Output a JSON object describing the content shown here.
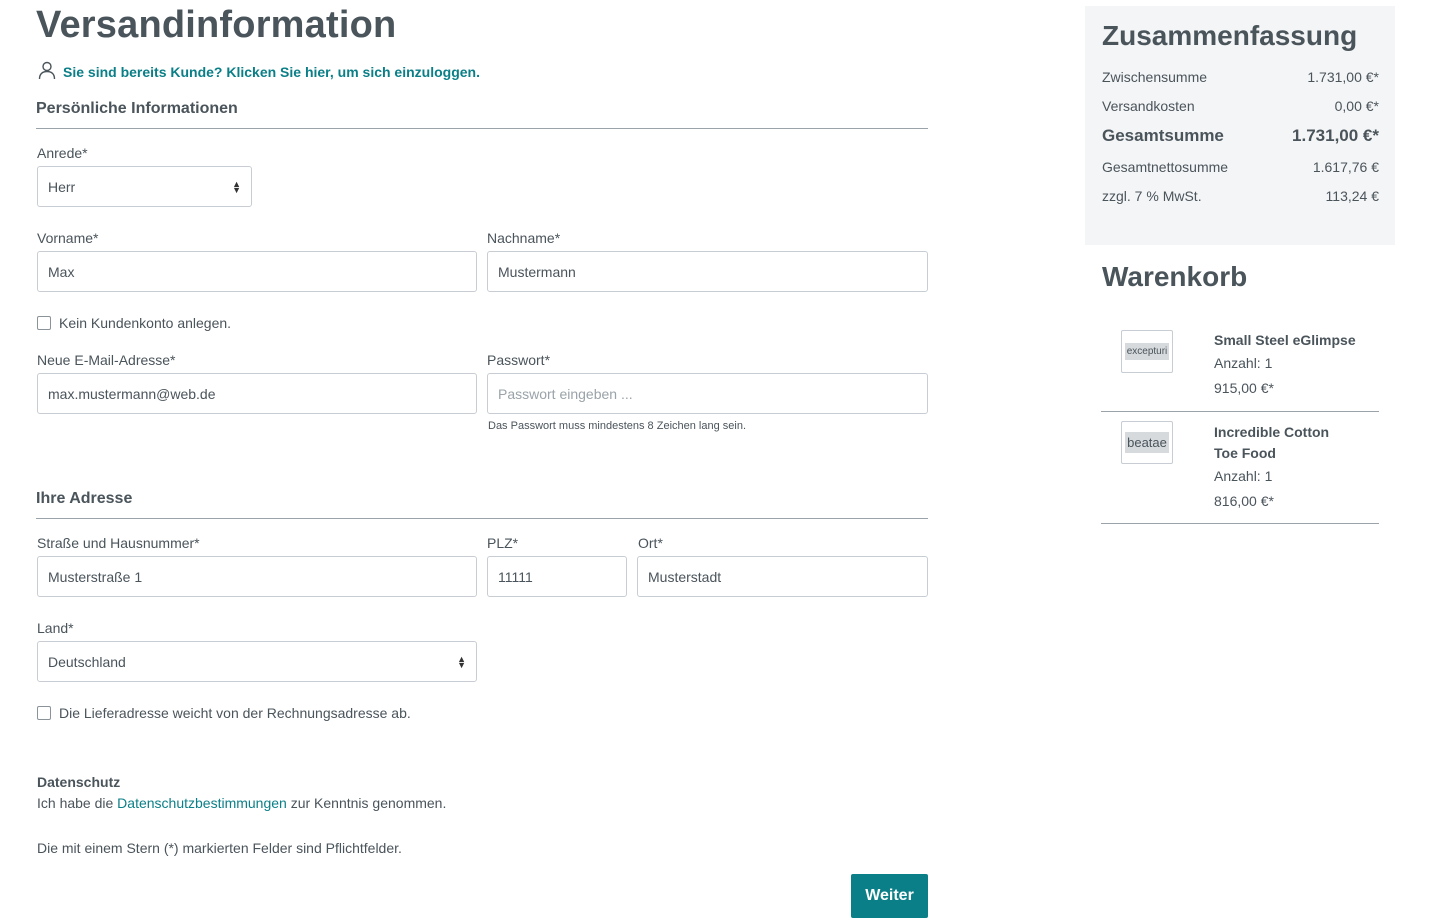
{
  "page": {
    "title": "Versandinformation",
    "login_link": "Sie sind bereits Kunde? Klicken Sie hier, um sich einzuloggen."
  },
  "personal": {
    "section_title": "Persönliche Informationen",
    "salutation": {
      "label": "Anrede*",
      "value": "Herr"
    },
    "first_name": {
      "label": "Vorname*",
      "value": "Max"
    },
    "last_name": {
      "label": "Nachname*",
      "value": "Mustermann"
    },
    "no_account": {
      "label": "Kein Kundenkonto anlegen.",
      "checked": false
    },
    "email": {
      "label": "Neue E-Mail-Adresse*",
      "value": "max.mustermann@web.de"
    },
    "password": {
      "label": "Passwort*",
      "placeholder": "Passwort eingeben ...",
      "hint": "Das Passwort muss mindestens 8 Zeichen lang sein."
    }
  },
  "address": {
    "section_title": "Ihre Adresse",
    "street": {
      "label": "Straße und Hausnummer*",
      "value": "Musterstraße 1"
    },
    "zip": {
      "label": "PLZ*",
      "value": "11111"
    },
    "city": {
      "label": "Ort*",
      "value": "Musterstadt"
    },
    "country": {
      "label": "Land*",
      "value": "Deutschland"
    },
    "different_shipping": {
      "label": "Die Lieferadresse weicht von der Rechnungsadresse ab.",
      "checked": false
    }
  },
  "privacy": {
    "title": "Datenschutz",
    "text_before": "Ich habe die ",
    "link": "Datenschutzbestimmungen",
    "text_after": " zur Kenntnis genommen."
  },
  "required_note": "Die mit einem Stern (*) markierten Felder sind Pflichtfelder.",
  "next_button": "Weiter",
  "summary": {
    "title": "Zusammenfassung",
    "rows": [
      {
        "label": "Zwischensumme",
        "value": "1.731,00 €*"
      },
      {
        "label": "Versandkosten",
        "value": "0,00 €*"
      },
      {
        "label": "Gesamtsumme",
        "value": "1.731,00 €*"
      },
      {
        "label": "Gesamtnettosumme",
        "value": "1.617,76 €"
      },
      {
        "label": "zzgl. 7 % MwSt.",
        "value": "113,24 €"
      }
    ]
  },
  "cart": {
    "title": "Warenkorb",
    "items": [
      {
        "thumb_text": "excepturi",
        "name": "Small Steel eGlimpse",
        "qty": "Anzahl: 1",
        "price": "915,00 €*"
      },
      {
        "thumb_text": "beatae",
        "name": "Incredible Cotton Toe Food",
        "qty": "Anzahl: 1",
        "price": "816,00 €*"
      }
    ]
  },
  "icons": {
    "login": "user-icon",
    "select_arrows": "sort-arrows-icon"
  },
  "colors": {
    "accent": "#0b7f87",
    "text": "#4a545b",
    "summary_bg": "#f4f5f6"
  }
}
